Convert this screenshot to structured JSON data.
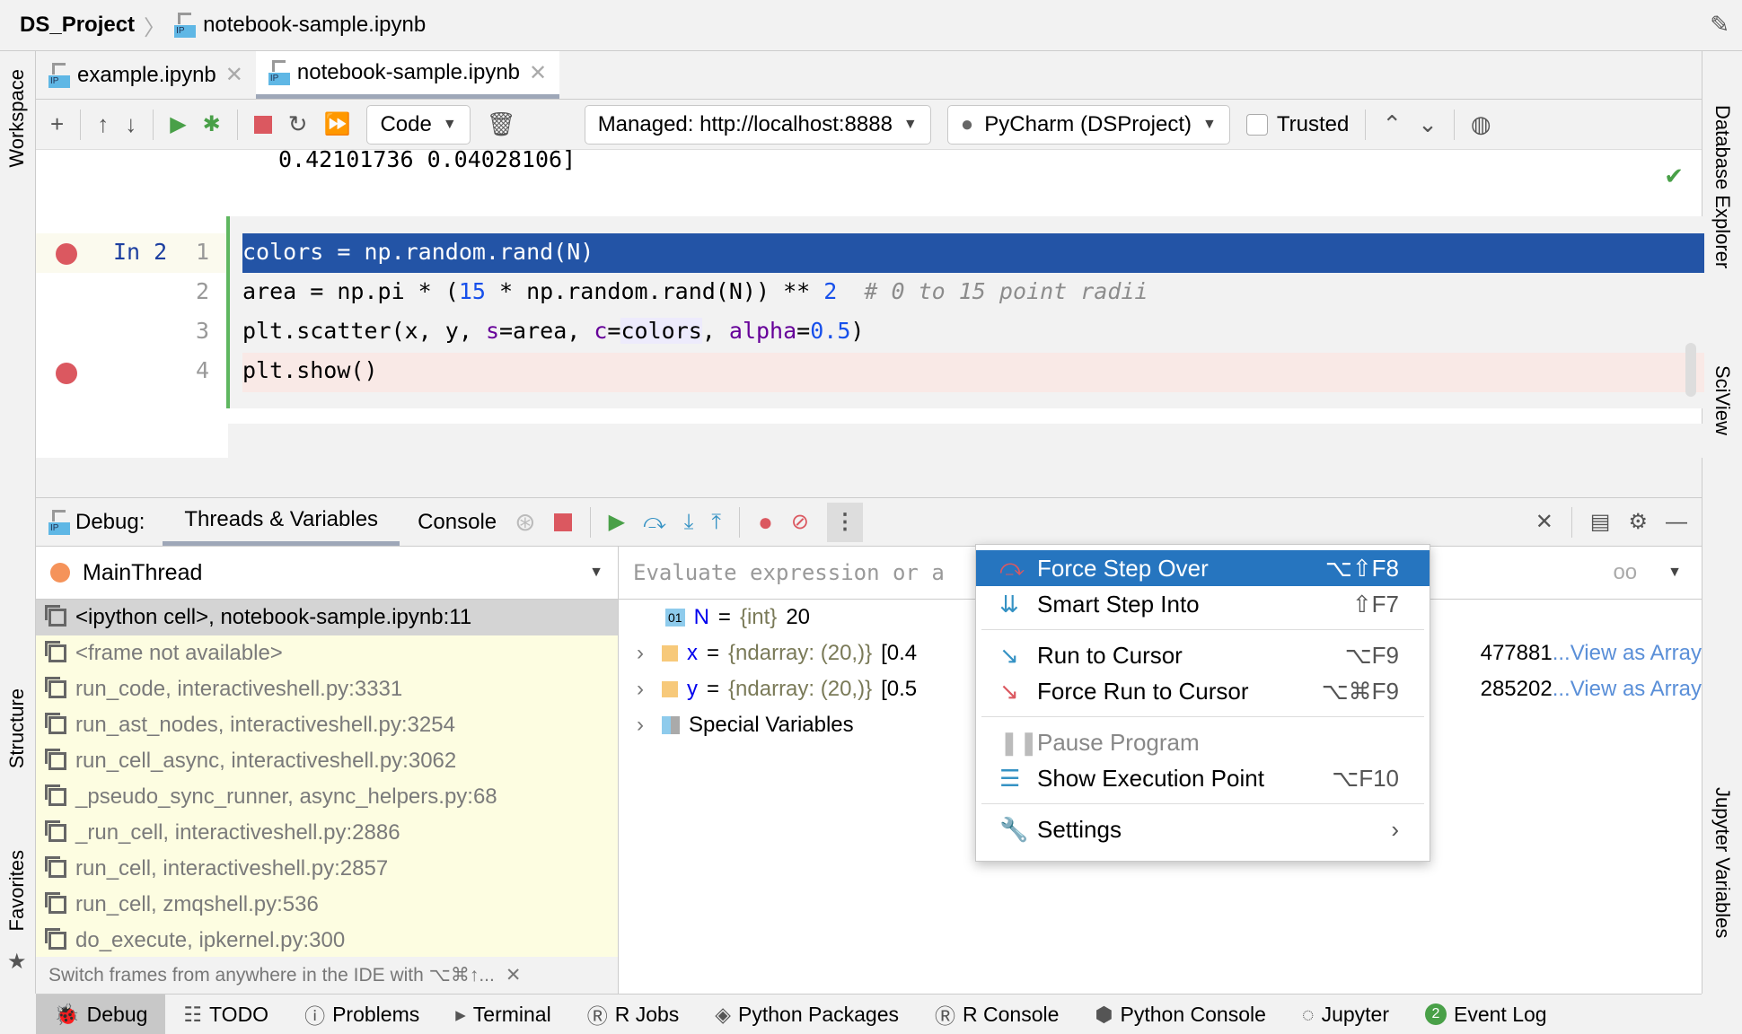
{
  "titlebar": {
    "project": "DS_Project",
    "file": "notebook-sample.ipynb"
  },
  "left_strip": {
    "workspace": "Workspace",
    "structure": "Structure",
    "favorites": "Favorites"
  },
  "right_strip": {
    "database": "Database Explorer",
    "sciview": "SciView",
    "jupyter": "Jupyter Variables"
  },
  "tabs": [
    {
      "label": "example.ipynb",
      "active": false
    },
    {
      "label": "notebook-sample.ipynb",
      "active": true
    }
  ],
  "toolbar": {
    "cell_type": "Code",
    "server": "Managed: http://localhost:8888",
    "kernel": "PyCharm (DSProject)",
    "trusted": "Trusted",
    "trusted_checked": false
  },
  "editor": {
    "output_line": "0.42101736 0.04028106]",
    "prompt": "In 2",
    "lines": [
      {
        "num": "1",
        "text": "colors = np.random.rand(N)",
        "breakpoint": true,
        "current": true
      },
      {
        "num": "2",
        "parts": [
          "area = np.pi * (",
          "15",
          " * np.random.rand(N)) ** ",
          "2",
          "  # 0 to 15 point radii"
        ]
      },
      {
        "num": "3",
        "parts": [
          "plt.scatter(x, y, ",
          "s",
          "=area, ",
          "c",
          "=",
          "colors",
          ", ",
          "alpha",
          "=",
          "0.5",
          ")"
        ]
      },
      {
        "num": "4",
        "text": "plt.show()",
        "breakpoint": true
      }
    ]
  },
  "debug": {
    "title": "Debug:",
    "tabs": [
      "Threads & Variables",
      "Console"
    ],
    "thread": "MainThread",
    "frames": [
      "<ipython cell>, notebook-sample.ipynb:11",
      "<frame not available>",
      "run_code, interactiveshell.py:3331",
      "run_ast_nodes, interactiveshell.py:3254",
      "run_cell_async, interactiveshell.py:3062",
      "_pseudo_sync_runner, async_helpers.py:68",
      "_run_cell, interactiveshell.py:2886",
      "run_cell, interactiveshell.py:2857",
      "run_cell, zmqshell.py:536",
      "do_execute, ipkernel.py:300"
    ],
    "hint": "Switch frames from anywhere in the IDE with ⌥⌘↑...",
    "eval_placeholder": "Evaluate expression or a",
    "variables": [
      {
        "name": "N",
        "type": "{int}",
        "value": "20"
      },
      {
        "name": "x",
        "type": "{ndarray: (20,)}",
        "value": "[0.4",
        "tail": "477881",
        "link": "...View as Array"
      },
      {
        "name": "y",
        "type": "{ndarray: (20,)}",
        "value": "[0.5",
        "tail": "285202",
        "link": "...View as Array"
      },
      {
        "name": "Special Variables"
      }
    ]
  },
  "menu": {
    "items": [
      {
        "label": "Force Step Over",
        "shortcut": "⌥⇧F8",
        "icon": "force-step-over-icon",
        "selected": true
      },
      {
        "label": "Smart Step Into",
        "shortcut": "⇧F7",
        "icon": "smart-step-into-icon"
      },
      {
        "label": "Run to Cursor",
        "shortcut": "⌥F9",
        "icon": "run-to-cursor-icon"
      },
      {
        "label": "Force Run to Cursor",
        "shortcut": "⌥⌘F9",
        "icon": "force-run-to-cursor-icon"
      },
      {
        "label": "Pause Program",
        "shortcut": "",
        "icon": "pause-icon",
        "disabled": true
      },
      {
        "label": "Show Execution Point",
        "shortcut": "⌥F10",
        "icon": "execution-point-icon"
      },
      {
        "label": "Settings",
        "shortcut": "",
        "icon": "wrench-icon",
        "submenu": true
      }
    ]
  },
  "bottom_bar": [
    "Debug",
    "TODO",
    "Problems",
    "Terminal",
    "R Jobs",
    "Python Packages",
    "R Console",
    "Python Console",
    "Jupyter",
    "Event Log"
  ],
  "event_log_count": "2",
  "colors": {
    "selection": "#2354a6",
    "menu_highlight": "#2675bf",
    "breakpoint": "#db5860",
    "frames_bg": "#fdfde1",
    "link": "#5a8fd8"
  }
}
